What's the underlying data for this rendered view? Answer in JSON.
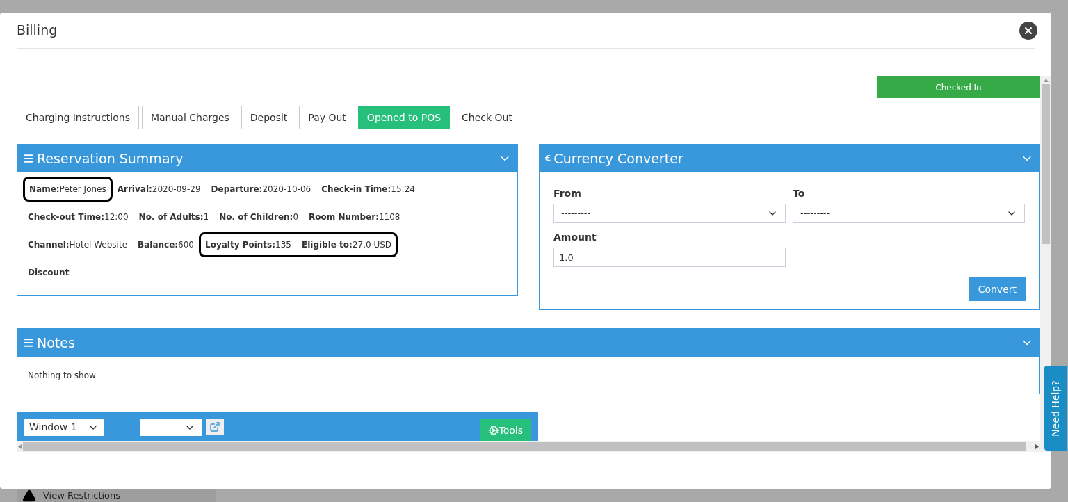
{
  "dialog": {
    "title": "Billing"
  },
  "status_badge": "Checked In",
  "tabs": [
    {
      "label": "Charging Instructions",
      "selected": false
    },
    {
      "label": "Manual Charges",
      "selected": false
    },
    {
      "label": "Deposit",
      "selected": false
    },
    {
      "label": "Pay Out",
      "selected": false
    },
    {
      "label": "Opened to POS",
      "selected": true
    },
    {
      "label": "Check Out",
      "selected": false
    }
  ],
  "reservation_summary": {
    "title": "Reservation Summary",
    "expanded": true,
    "rows": [
      [
        {
          "highlighted": true,
          "fields": [
            {
              "label": "Name:",
              "value": "Peter Jones"
            }
          ]
        },
        {
          "highlighted": false,
          "fields": [
            {
              "label": "Arrival:",
              "value": "2020-09-29"
            },
            {
              "label": "Departure:",
              "value": "2020-10-06"
            },
            {
              "label": "Check-in Time:",
              "value": "15:24"
            }
          ]
        }
      ],
      [
        {
          "highlighted": false,
          "fields": [
            {
              "label": "Check-out Time:",
              "value": "12:00"
            },
            {
              "label": "No. of Adults:",
              "value": "1"
            },
            {
              "label": "No. of Children:",
              "value": "0"
            },
            {
              "label": "Room Number:",
              "value": "1108"
            }
          ]
        }
      ],
      [
        {
          "highlighted": false,
          "fields": [
            {
              "label": "Channel:",
              "value": "Hotel Website"
            },
            {
              "label": "Balance:",
              "value": "600"
            }
          ]
        },
        {
          "highlighted": true,
          "fields": [
            {
              "label": "Loyalty Points:",
              "value": "135"
            },
            {
              "label": "Eligible to:",
              "value": "27.0 USD"
            }
          ]
        }
      ],
      [
        {
          "highlighted": false,
          "fields": [
            {
              "label": "Discount"
            }
          ]
        }
      ]
    ]
  },
  "currency_converter": {
    "title": "Currency Converter",
    "symbol": "€",
    "from_label": "From",
    "from_value": "---------",
    "to_label": "To",
    "to_value": "---------",
    "amount_label": "Amount",
    "amount_value": "1.0",
    "button": "Convert"
  },
  "notes": {
    "title": "Notes",
    "empty_text": "Nothing to show"
  },
  "window_bar": {
    "window_select": "Window 1",
    "second_select": "-----------",
    "tools_button": "Tools"
  },
  "need_help": "Need Help?",
  "background_bar": {
    "label": "View Restrictions"
  }
}
